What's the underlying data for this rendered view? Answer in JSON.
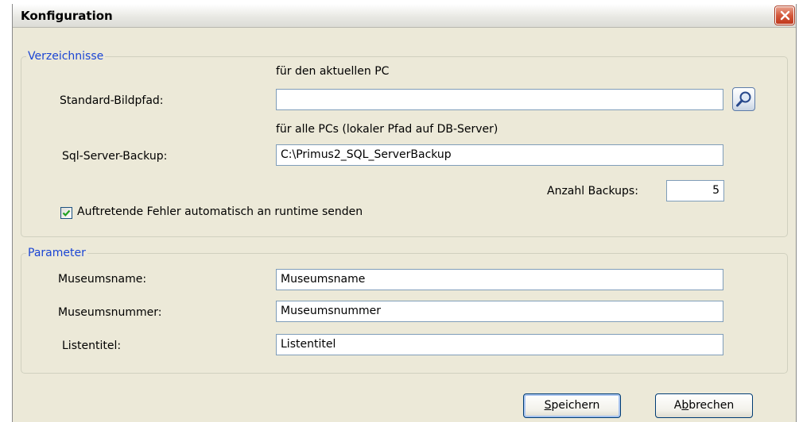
{
  "window": {
    "title": "Konfiguration"
  },
  "verzeichnisse": {
    "legend": "Verzeichnisse",
    "hint_current_pc": "für den aktuellen PC",
    "standard_bildpfad_label": "Standard-Bildpfad:",
    "standard_bildpfad_value": "",
    "hint_all_pcs": "für alle PCs (lokaler Pfad auf DB-Server)",
    "sql_backup_label": "Sql-Server-Backup:",
    "sql_backup_value": "C:\\Primus2_SQL_ServerBackup",
    "anzahl_backups_label": "Anzahl Backups:",
    "anzahl_backups_value": "5",
    "auto_error_label": "Auftretende Fehler automatisch an runtime senden",
    "auto_error_checked": true
  },
  "parameter": {
    "legend": "Parameter",
    "museumsname_label": "Museumsname:",
    "museumsname_value": "Museumsname",
    "museumsnummer_label": "Museumsnummer:",
    "museumsnummer_value": "Museumsnummer",
    "listentitel_label": "Listentitel:",
    "listentitel_value": "Listentitel"
  },
  "buttons": {
    "save_mnemonic": "S",
    "save_rest": "peichern",
    "cancel_prefix": "A",
    "cancel_mnemonic": "b",
    "cancel_rest": "brechen"
  },
  "icons": {
    "close": "close-icon",
    "browse": "magnifier-icon",
    "check": "checkmark-icon"
  }
}
